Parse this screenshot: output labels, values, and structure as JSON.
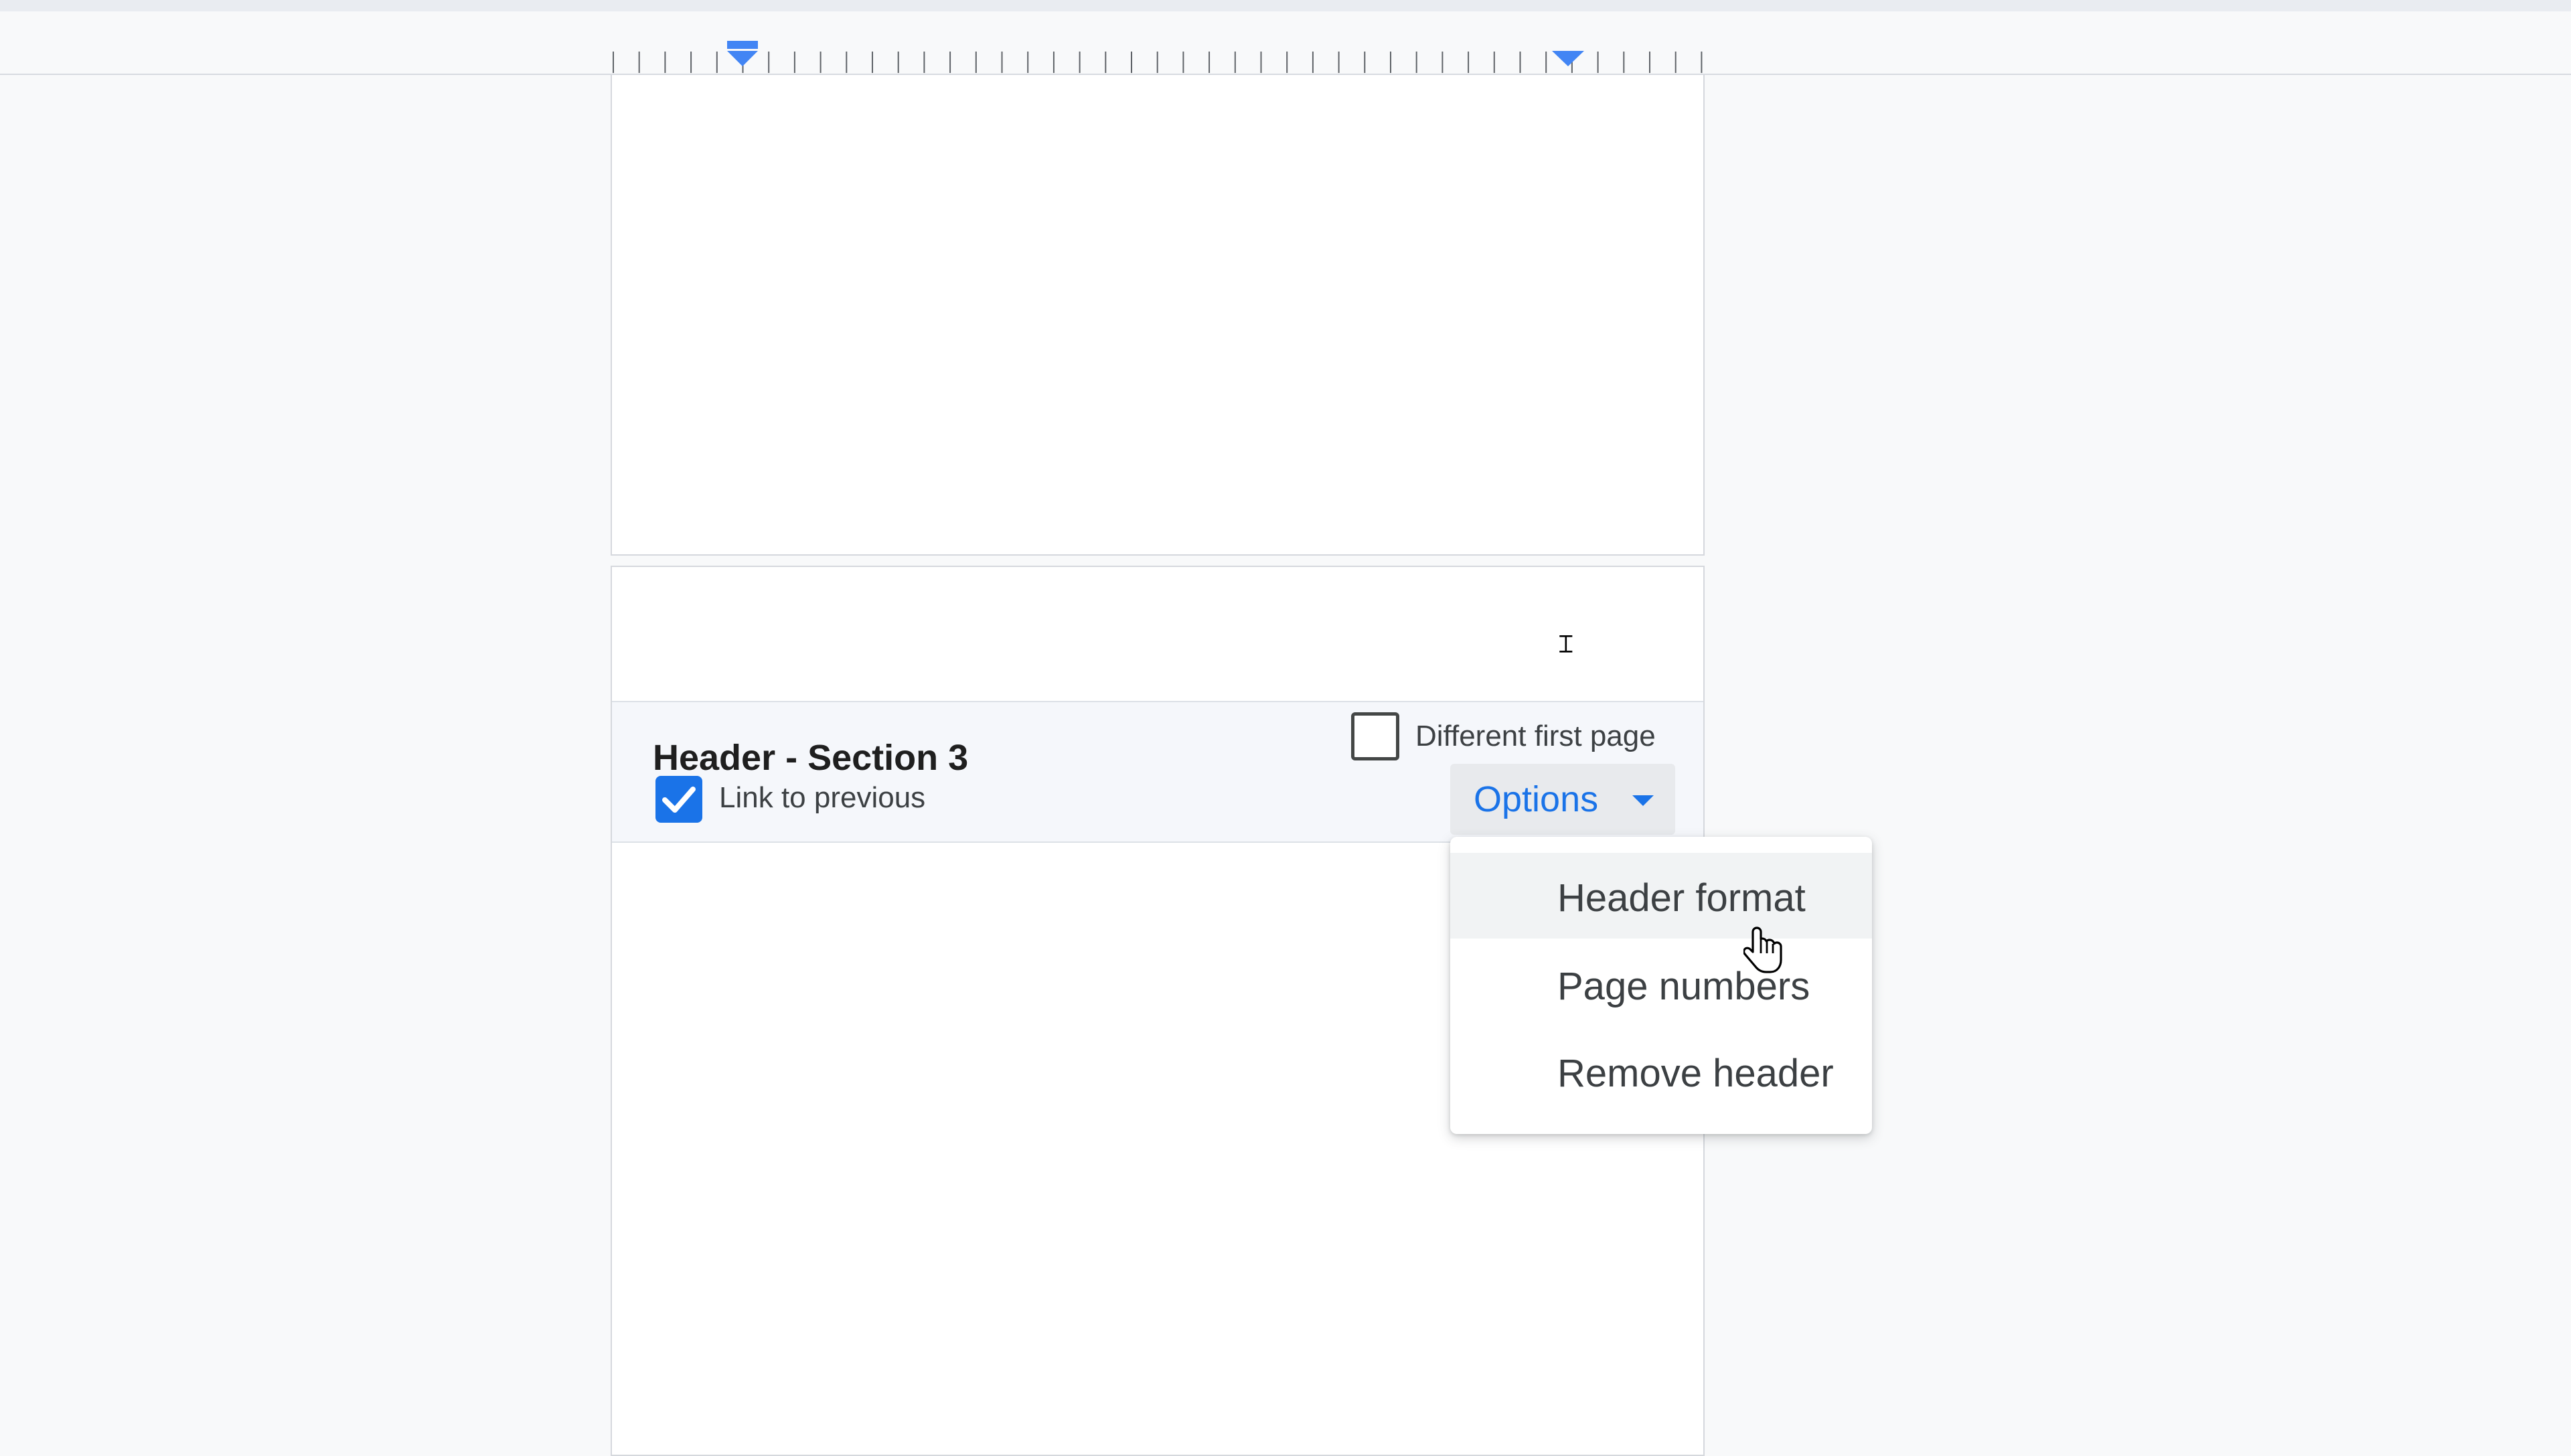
{
  "header_bar": {
    "title": "Header - Section 3",
    "link_to_previous": {
      "label": "Link to previous",
      "checked": true
    },
    "different_first_page": {
      "label": "Different first page",
      "checked": false
    },
    "options_button": {
      "label": "Options",
      "icon": "caret-down-icon"
    }
  },
  "options_menu": {
    "items": [
      {
        "label": "Header format",
        "hovered": true
      },
      {
        "label": "Page numbers",
        "hovered": false
      },
      {
        "label": "Remove header",
        "hovered": false
      }
    ]
  },
  "ruler": {
    "left_indent_icon": "indent-marker-icon",
    "right_indent_icon": "right-indent-marker-icon"
  },
  "colors": {
    "accent": "#1a73e8",
    "background": "#f8f9fa",
    "header_bar_bg": "#f5f7fb",
    "menu_hover": "#f1f3f4",
    "text": "#3c4043"
  },
  "cursor": {
    "icon": "hand-pointer-icon"
  }
}
